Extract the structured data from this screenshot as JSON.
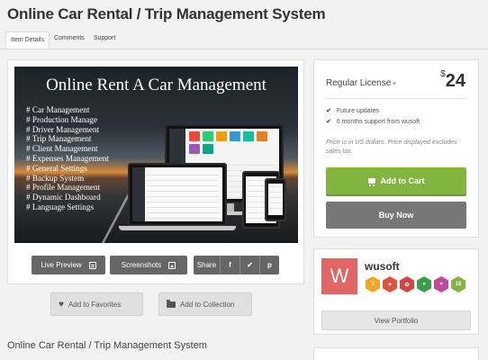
{
  "page": {
    "title": "Online Car Rental / Trip Management System"
  },
  "tabs": [
    {
      "label": "Item Details",
      "active": true
    },
    {
      "label": "Comments",
      "active": false
    },
    {
      "label": "Support",
      "active": false
    }
  ],
  "preview": {
    "banner_title": "Online Rent A Car Management",
    "features": [
      "# Car Management",
      "# Production Manage",
      "# Driver Management",
      "# Trip Management",
      "# Client Management",
      "# Expenses Management",
      "# General Settings",
      "# Backup System",
      "# Profile Management",
      "# Dynamic Dashboard",
      "# Language Settings"
    ],
    "tile_colors": [
      "#e74c3c",
      "#2ecc71",
      "#f39c12",
      "#3498db",
      "#1abc9c",
      "#e67e22",
      "#9b59b6",
      "#16a085"
    ]
  },
  "actions": {
    "live_preview_label": "Live Preview",
    "screenshots_label": "Screenshots",
    "share_label": "Share",
    "share_icons": {
      "facebook": "f",
      "twitter": "✔",
      "pinterest": "p"
    },
    "add_favorites_label": "Add to Favorites",
    "add_collection_label": "Add to Collection"
  },
  "item_subtitle": "Online Car Rental / Trip Management System",
  "license": {
    "name": "Regular License",
    "caret": "▾",
    "currency": "$",
    "price": "24",
    "features": [
      "Future updates",
      "6 months support from wusoft"
    ],
    "price_note": "Price is in US dollars. Price displayed excludes sales tax.",
    "add_to_cart_label": "Add to Cart",
    "buy_now_label": "Buy Now"
  },
  "author": {
    "avatar_letter": "W",
    "name": "wusoft",
    "badges": [
      {
        "icon": "3",
        "color": "#f5a623"
      },
      {
        "icon": "✦",
        "color": "#e0533b"
      },
      {
        "icon": "✿",
        "color": "#d64545"
      },
      {
        "icon": "●",
        "color": "#3a9e4a"
      },
      {
        "icon": "♥",
        "color": "#c2469e"
      },
      {
        "icon": "18",
        "color": "#82b440"
      }
    ],
    "view_portfolio_label": "View Portfolio"
  },
  "colors": {
    "green": "#82b440",
    "dark_button": "#666666",
    "avatar_bg": "#e26565"
  }
}
